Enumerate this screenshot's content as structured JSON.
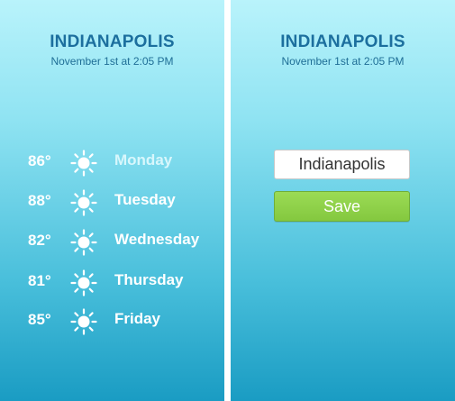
{
  "colors": {
    "accent_text": "#1c6f9e",
    "save_button": "#8fd14a",
    "panel_top": "#b9f3fb",
    "panel_bottom": "#1a9cc3"
  },
  "forecast_screen": {
    "city": "INDIANAPOLIS",
    "timestamp": "November 1st at 2:05 PM",
    "days": [
      {
        "temp": "86°",
        "day": "Monday",
        "icon": "sun-icon"
      },
      {
        "temp": "88°",
        "day": "Tuesday",
        "icon": "sun-icon"
      },
      {
        "temp": "82°",
        "day": "Wednesday",
        "icon": "sun-icon"
      },
      {
        "temp": "81°",
        "day": "Thursday",
        "icon": "sun-icon"
      },
      {
        "temp": "85°",
        "day": "Friday",
        "icon": "sun-icon"
      }
    ]
  },
  "settings_screen": {
    "city": "INDIANAPOLIS",
    "timestamp": "November 1st at 2:05 PM",
    "city_input": {
      "value": "Indianapolis"
    },
    "save_label": "Save"
  }
}
